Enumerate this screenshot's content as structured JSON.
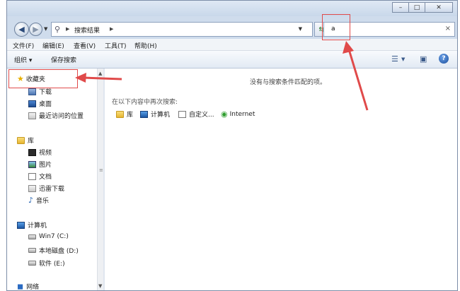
{
  "window": {
    "min_glyph": "–",
    "max_glyph": "□",
    "close_glyph": "✕"
  },
  "address": {
    "breadcrumb": "搜索结果",
    "search_value": "a"
  },
  "menu": [
    {
      "label": "文件(F)"
    },
    {
      "label": "编辑(E)"
    },
    {
      "label": "查看(V)"
    },
    {
      "label": "工具(T)"
    },
    {
      "label": "帮助(H)"
    }
  ],
  "toolbar": {
    "organize": "组织 ▾",
    "save_search": "保存搜索",
    "help": "?"
  },
  "nav": {
    "favorites": {
      "label": "收藏夹",
      "items": [
        {
          "label": "下载",
          "icon": "download-folder-icon"
        },
        {
          "label": "桌面",
          "icon": "desktop-icon"
        },
        {
          "label": "最近访问的位置",
          "icon": "recent-places-icon"
        }
      ]
    },
    "libraries": {
      "label": "库",
      "items": [
        {
          "label": "视频",
          "icon": "video-icon"
        },
        {
          "label": "图片",
          "icon": "picture-icon"
        },
        {
          "label": "文档",
          "icon": "document-icon"
        },
        {
          "label": "迅雷下载",
          "icon": "thunder-download-icon"
        },
        {
          "label": "音乐",
          "icon": "music-icon"
        }
      ]
    },
    "computer": {
      "label": "计算机",
      "items": [
        {
          "label": "Win7 (C:)",
          "icon": "drive-c-icon"
        },
        {
          "label": "本地磁盘 (D:)",
          "icon": "drive-d-icon"
        },
        {
          "label": "软件 (E:)",
          "icon": "drive-e-icon"
        }
      ]
    },
    "network": {
      "label": "网络"
    }
  },
  "content": {
    "no_results": "没有与搜索条件匹配的项。",
    "search_again": "在以下内容中再次搜索:",
    "locations": [
      {
        "label": "库"
      },
      {
        "label": "计算机"
      },
      {
        "label": "自定义..."
      },
      {
        "label": "Internet"
      }
    ]
  },
  "colors": {
    "annotation": "#e04a4a"
  }
}
